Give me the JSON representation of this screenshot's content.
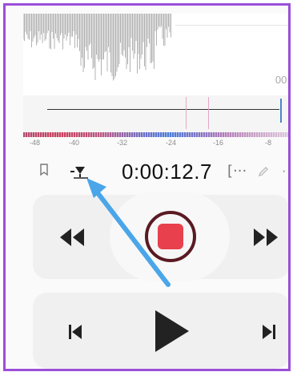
{
  "waveform": {
    "timestamp": "00:"
  },
  "meter": {
    "scale": [
      "-48",
      "-40",
      "-32",
      "-24",
      "-16",
      "-8"
    ]
  },
  "toolbar": {
    "time": "0:00:12.7",
    "bracket_label": "[···",
    "more_label": "·"
  },
  "colors": {
    "frame": "#9b4fd8",
    "stop": "#e8404c",
    "stop_ring": "#5a1a22",
    "playhead": "#4a86c5",
    "annotation": "#4aa6e8"
  },
  "icons": [
    "bookmark-icon",
    "trim-icon",
    "bracket-icon",
    "pencil-icon",
    "more-icon",
    "rewind-icon",
    "stop-icon",
    "fast-forward-icon",
    "skip-previous-icon",
    "play-icon",
    "skip-next-icon"
  ]
}
